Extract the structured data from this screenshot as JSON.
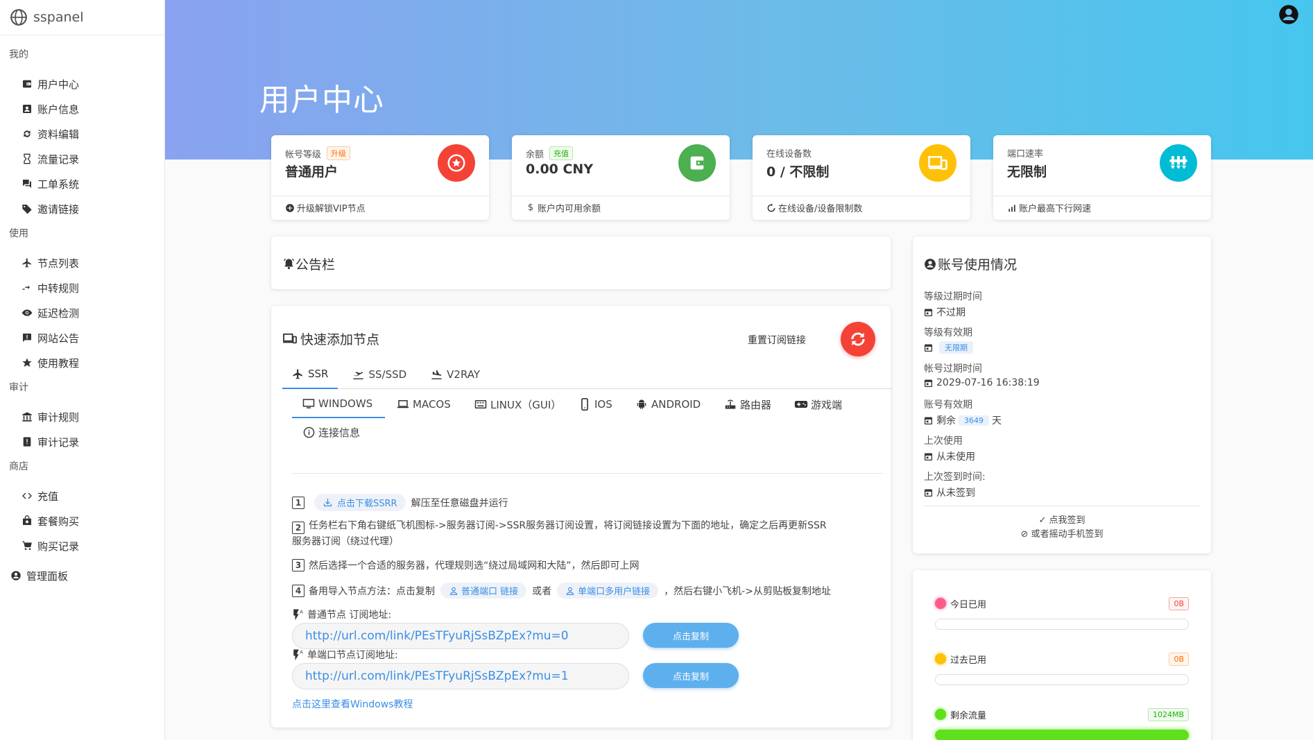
{
  "brand": {
    "name": "sspanel"
  },
  "sidebar": {
    "sections": [
      {
        "title": "我的",
        "items": [
          {
            "label": "用户中心",
            "icon": "wallet-icon"
          },
          {
            "label": "账户信息",
            "icon": "account-box-icon"
          },
          {
            "label": "资料编辑",
            "icon": "sync-icon"
          },
          {
            "label": "流量记录",
            "icon": "hourglass-icon"
          },
          {
            "label": "工单系统",
            "icon": "forum-icon"
          },
          {
            "label": "邀请链接",
            "icon": "tag-icon"
          }
        ]
      },
      {
        "title": "使用",
        "items": [
          {
            "label": "节点列表",
            "icon": "airplane-icon"
          },
          {
            "label": "中转规则",
            "icon": "transfer-icon"
          },
          {
            "label": "延迟检测",
            "icon": "eye-icon"
          },
          {
            "label": "网站公告",
            "icon": "announcement-icon"
          },
          {
            "label": "使用教程",
            "icon": "star-icon"
          }
        ]
      },
      {
        "title": "审计",
        "items": [
          {
            "label": "审计规则",
            "icon": "bank-icon"
          },
          {
            "label": "审计记录",
            "icon": "alert-box-icon"
          }
        ]
      },
      {
        "title": "商店",
        "items": [
          {
            "label": "充值",
            "icon": "code-icon"
          },
          {
            "label": "套餐购买",
            "icon": "shopping-bag-icon"
          },
          {
            "label": "购买记录",
            "icon": "cart-icon"
          }
        ]
      }
    ],
    "admin": {
      "label": "管理面板",
      "icon": "user-circle-icon"
    }
  },
  "header": {
    "title": "用户中心"
  },
  "stats": [
    {
      "label": "帐号等级",
      "tag": "升级",
      "value": "普通用户",
      "foot": "升级解锁VIP节点",
      "color": "#f44336",
      "icon": "star-circle-icon",
      "foot_icon": "plus-circle-icon"
    },
    {
      "label": "余额",
      "tag": "充值",
      "value": "0.00 CNY",
      "foot": "账户内可用余额",
      "color": "#4caf50",
      "icon": "wallet-icon",
      "foot_icon": "dollar-icon"
    },
    {
      "label": "在线设备数",
      "tag": "",
      "value": "0 / 不限制",
      "foot": "在线设备/设备限制数",
      "color": "#ffc107",
      "icon": "devices-icon",
      "foot_icon": "loop-icon"
    },
    {
      "label": "端口速率",
      "tag": "",
      "value": "无限制",
      "foot": "账户最高下行网速",
      "color": "#00bcd4",
      "icon": "speed-icon",
      "foot_icon": "signal-bars-icon"
    }
  ],
  "announcement": {
    "title": "公告栏"
  },
  "quick_add": {
    "title": "快速添加节点",
    "reset_label": "重置订阅链接",
    "protocol_tabs": [
      "SSR",
      "SS/SSD",
      "V2RAY"
    ],
    "platform_tabs": [
      "WINDOWS",
      "MACOS",
      "LINUX（GUI）",
      "IOS",
      "ANDROID",
      "路由器",
      "游戏端",
      "连接信息"
    ],
    "steps": {
      "s1_chip": "点击下载SSRR",
      "s1_text": "解压至任意磁盘并运行",
      "s2_text": "任务栏右下角右键纸飞机图标->服务器订阅->SSR服务器订阅设置，将订阅链接设置为下面的地址，确定之后再更新SSR",
      "s2_text2": "服务器订阅（绕过代理）",
      "s3_text": "然后选择一个合适的服务器，代理规则选“绕过局域网和大陆”，然后即可上网",
      "s4_prefix": "备用导入节点方法：点击复制",
      "s4_chip1": "普通端口 链接",
      "s4_mid": "或者",
      "s4_chip2": "单端口多用户链接",
      "s4_suffix": "，然后右键小飞机->从剪贴板复制地址"
    },
    "normal_label": "普通节点 订阅地址:",
    "normal_url": "http://url.com/link/PEsTFyuRjSsBZpEx?mu=0",
    "single_label": "单端口节点订阅地址:",
    "single_url": "http://url.com/link/PEsTFyuRjSsBZpEx?mu=1",
    "copy_label": "点击复制",
    "tutorial_link": "点击这里查看Windows教程"
  },
  "account": {
    "title": "账号使用情况",
    "items": [
      {
        "label": "等级过期时间",
        "value": "不过期"
      },
      {
        "label": "等级有效期",
        "value": "无限期"
      },
      {
        "label": "帐号过期时间",
        "value": "2029-07-16 16:38:19"
      },
      {
        "label": "账号有效期",
        "prefix": "剩余",
        "value": "3649",
        "suffix": "天"
      },
      {
        "label": "上次使用",
        "value": "从未使用"
      },
      {
        "label": "上次签到时间:",
        "value": "从未签到"
      }
    ],
    "checkin": "点我签到",
    "shake": "或者摇动手机签到"
  },
  "traffic": {
    "today": {
      "label": "今日已用",
      "value": "0B",
      "color": "#ff5c8a",
      "fraction": 0
    },
    "past": {
      "label": "过去已用",
      "value": "0B",
      "color": "#ffc107",
      "fraction": 0
    },
    "remain": {
      "label": "剩余流量",
      "value": "1024MB",
      "color": "#5ee01c",
      "fraction": 1
    }
  }
}
